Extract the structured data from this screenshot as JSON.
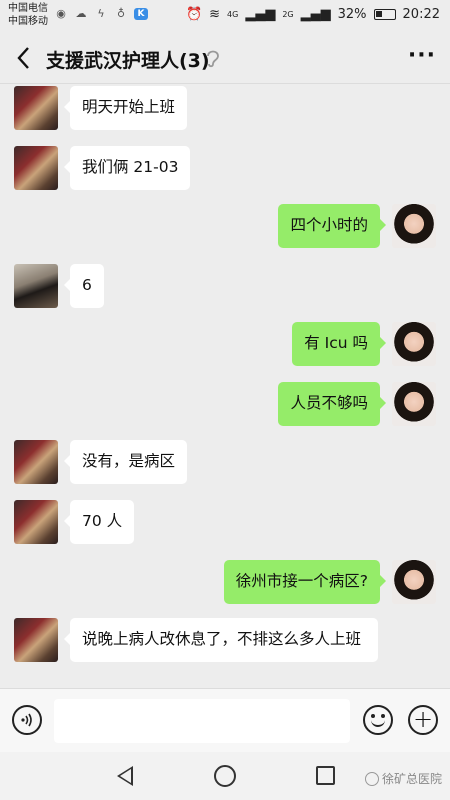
{
  "status_bar": {
    "carrier_1": "中国电信",
    "carrier_2": "中国移动",
    "network": "4G",
    "network_2": "2G",
    "battery": "32%",
    "time": "20:22"
  },
  "header": {
    "title": "支援武汉护理人(3)",
    "more": "···"
  },
  "messages": [
    {
      "side": "left",
      "avatar": "avatar-a",
      "text": "明天开始上班"
    },
    {
      "side": "left",
      "avatar": "avatar-a",
      "text": "我们俩 21-03"
    },
    {
      "side": "right",
      "avatar": "avatar-me",
      "text": "四个小时的"
    },
    {
      "side": "left",
      "avatar": "avatar-b",
      "text": "6"
    },
    {
      "side": "right",
      "avatar": "avatar-me",
      "text": "有 Icu 吗"
    },
    {
      "side": "right",
      "avatar": "avatar-me",
      "text": "人员不够吗"
    },
    {
      "side": "left",
      "avatar": "avatar-a",
      "text": "没有，是病区"
    },
    {
      "side": "left",
      "avatar": "avatar-a",
      "text": "70 人"
    },
    {
      "side": "right",
      "avatar": "avatar-me",
      "text": "徐州市接一个病区?"
    },
    {
      "side": "left",
      "avatar": "avatar-a",
      "text": "说晚上病人改休息了，不排这么多人上班"
    }
  ],
  "input": {
    "placeholder": ""
  },
  "watermark": "徐矿总医院",
  "colors": {
    "outgoing_bubble": "#95ec69",
    "incoming_bubble": "#ffffff",
    "background": "#ededed"
  }
}
